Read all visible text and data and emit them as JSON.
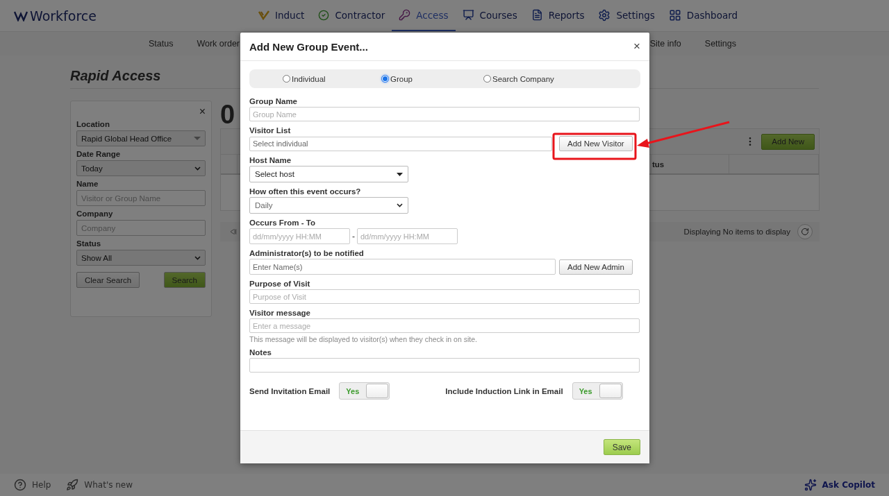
{
  "header": {
    "logo": "Workforce",
    "nav": [
      {
        "label": "Induct",
        "selected": false
      },
      {
        "label": "Contractor",
        "selected": false
      },
      {
        "label": "Access",
        "selected": true
      },
      {
        "label": "Courses",
        "selected": false
      },
      {
        "label": "Reports",
        "selected": false
      },
      {
        "label": "Settings",
        "selected": false
      },
      {
        "label": "Dashboard",
        "selected": false
      }
    ]
  },
  "subnav": {
    "left": [
      "Status",
      "Work order"
    ],
    "right": [
      "Site info",
      "Settings"
    ]
  },
  "page": {
    "title": "Rapid Access",
    "count": "0"
  },
  "filters": {
    "close": "×",
    "fields": [
      {
        "kind": "select",
        "label": "Location",
        "value": "Rapid Global Head Office"
      },
      {
        "kind": "select",
        "label": "Date Range",
        "value": "Today"
      },
      {
        "kind": "input",
        "label": "Name",
        "placeholder": "Visitor or Group Name"
      },
      {
        "kind": "input",
        "label": "Company",
        "placeholder": "Company"
      },
      {
        "kind": "select",
        "label": "Status",
        "value": "Show All"
      }
    ],
    "buttons": [
      "Clear Search",
      "Search"
    ]
  },
  "table": {
    "add_button": "Add New",
    "columns": [
      "tus"
    ]
  },
  "pager": {
    "text": "Displaying No items to display"
  },
  "footer": {
    "help": "Help",
    "whats_new": "What's new",
    "copilot": "Ask Copilot"
  },
  "dialog": {
    "title": "Add New Group Event...",
    "close": "×",
    "modes": [
      {
        "label": "Individual",
        "selected": false
      },
      {
        "label": "Group",
        "selected": true
      },
      {
        "label": "Search Company",
        "selected": false
      }
    ],
    "group_name": {
      "label": "Group Name",
      "placeholder": "Group Name"
    },
    "visitor_list": {
      "label": "Visitor List",
      "placeholder": "Select individual",
      "button": "Add New Visitor"
    },
    "host": {
      "label": "Host Name",
      "value": "Select host"
    },
    "frequency": {
      "label": "How often this event occurs?",
      "value": "Daily"
    },
    "occurs": {
      "label": "Occurs From - To",
      "from_placeholder": "dd/mm/yyyy HH:MM",
      "separator": "-",
      "to_placeholder": "dd/mm/yyyy HH:MM"
    },
    "admins": {
      "label": "Administrator(s) to be notified",
      "placeholder": "Enter Name(s)",
      "button": "Add New Admin"
    },
    "purpose": {
      "label": "Purpose of Visit",
      "placeholder": "Purpose of Visit"
    },
    "message": {
      "label": "Visitor message",
      "placeholder": "Enter a message",
      "hint": "This message will be displayed to visitor(s) when they check in on site."
    },
    "notes": {
      "label": "Notes"
    },
    "toggles": [
      {
        "label": "Send Invitation Email",
        "text": "Yes",
        "on": true
      },
      {
        "label": "Include Induction Link in Email",
        "text": "Yes",
        "on": true
      }
    ],
    "save": "Save"
  }
}
